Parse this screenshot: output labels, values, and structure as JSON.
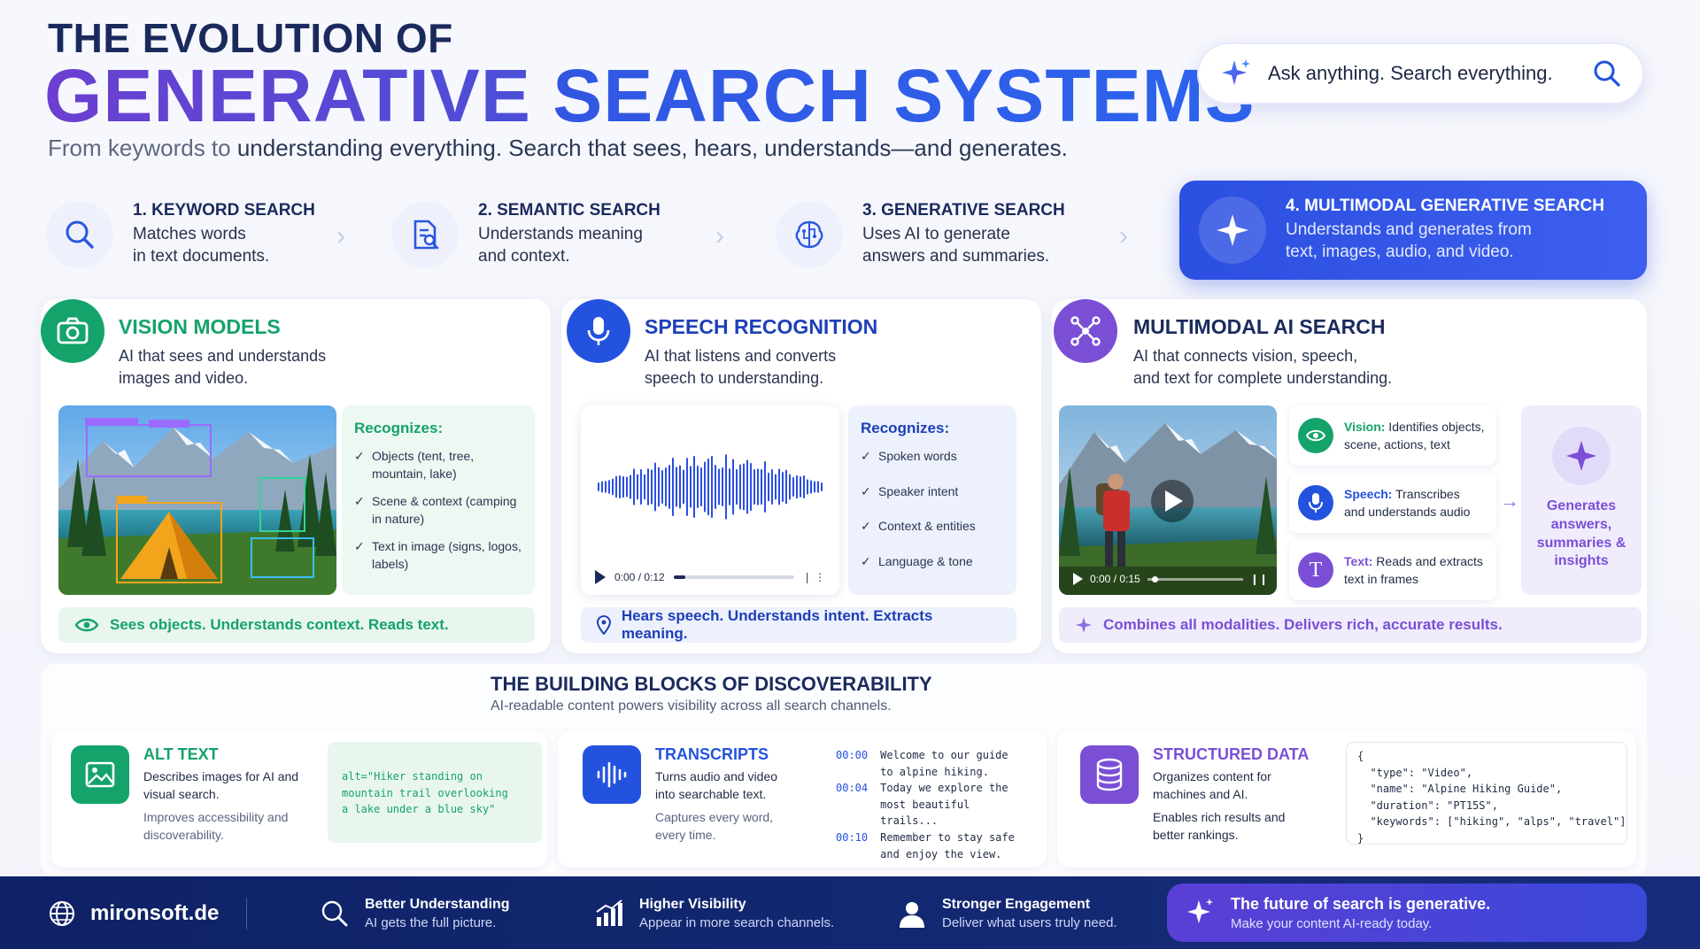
{
  "header": {
    "kicker": "THE EVOLUTION OF",
    "title_part1": "GENERATIVE",
    "title_part2": "SEARCH SYSTEMS",
    "subtitle_muted": "From keywords to",
    "subtitle_rest": " understanding everything. Search that sees, hears, understands—and generates."
  },
  "search": {
    "placeholder": "Ask anything. Search everything."
  },
  "steps": [
    {
      "title": "1. KEYWORD SEARCH",
      "line1": "Matches words",
      "line2": "in text documents."
    },
    {
      "title": "2. SEMANTIC SEARCH",
      "line1": "Understands meaning",
      "line2": "and context."
    },
    {
      "title": "3. GENERATIVE SEARCH",
      "line1": "Uses AI to generate",
      "line2": "answers and summaries."
    },
    {
      "title": "4. MULTIMODAL GENERATIVE SEARCH",
      "line1": "Understands and generates from",
      "line2": "text, images, audio, and video."
    }
  ],
  "vision": {
    "title": "VISION MODELS",
    "line1": "AI that sees and understands",
    "line2": "images and video.",
    "recognizes_label": "Recognizes:",
    "items": [
      "Objects (tent, tree, mountain, lake)",
      "Scene & context (camping in nature)",
      "Text in image (signs, logos, labels)"
    ],
    "footer": "Sees objects. Understands context. Reads text."
  },
  "speech": {
    "title": "SPEECH RECOGNITION",
    "line1": "AI that listens and converts",
    "line2": "speech to understanding.",
    "time": "0:00 / 0:12",
    "player_progress": 0.1,
    "recognizes_label": "Recognizes:",
    "items": [
      "Spoken words",
      "Speaker intent",
      "Context & entities",
      "Language & tone"
    ],
    "footer": "Hears speech. Understands intent. Extracts meaning."
  },
  "multimodal": {
    "title": "MULTIMODAL AI SEARCH",
    "line1": "AI that connects vision, speech,",
    "line2": "and text for complete understanding.",
    "time": "0:00 / 0:15",
    "player_progress": 0.05,
    "modes": [
      {
        "label": "Vision:",
        "text": " Identifies objects,",
        "text2": "scene, actions, text"
      },
      {
        "label": "Speech:",
        "text": " Transcribes",
        "text2": "and understands audio"
      },
      {
        "label": "Text:",
        "text": " Reads and extracts",
        "text2": "text in frames"
      }
    ],
    "text_icon_glyph": "T",
    "output": "Generates answers, summaries & insights",
    "footer": "Combines all modalities. Delivers rich, accurate results."
  },
  "blocks": {
    "title": "THE BUILDING BLOCKS OF DISCOVERABILITY",
    "subtitle": "AI-readable content powers visibility across all search channels.",
    "alt": {
      "title": "ALT TEXT",
      "d1": "Describes images for AI and",
      "d2": "visual search.",
      "m1": "Improves accessibility and",
      "m2": "discoverability.",
      "code": [
        "alt=\"Hiker standing on",
        "mountain trail overlooking",
        "a lake under a blue sky\""
      ]
    },
    "transcripts": {
      "title": "TRANSCRIPTS",
      "d1": "Turns audio and video",
      "d2": "into searchable text.",
      "m1": "Captures every word,",
      "m2": "every time.",
      "lines": [
        {
          "ts": "00:00",
          "l1": "Welcome to our guide",
          "l2": "to alpine hiking."
        },
        {
          "ts": "00:04",
          "l1": "Today we explore the",
          "l2": "most beautiful trails..."
        },
        {
          "ts": "00:10",
          "l1": "Remember to stay safe",
          "l2": "and enjoy the view."
        }
      ]
    },
    "structured": {
      "title": "STRUCTURED DATA",
      "d1": "Organizes content for",
      "d2": "machines and AI.",
      "m1": "Enables rich results and",
      "m2": "better rankings.",
      "json": [
        "{",
        "  \"type\": \"Video\",",
        "  \"name\": \"Alpine Hiking Guide\",",
        "  \"duration\": \"PT15S\",",
        "  \"keywords\": [\"hiking\", \"alps\", \"travel\"]",
        "}"
      ]
    }
  },
  "footer": {
    "brand": "mironsoft.de",
    "items": [
      {
        "title": "Better Understanding",
        "desc": "AI gets the full picture."
      },
      {
        "title": "Higher Visibility",
        "desc": "Appear in more search channels."
      },
      {
        "title": "Stronger Engagement",
        "desc": "Deliver what users truly need."
      }
    ],
    "cta_title": "The future of search is generative.",
    "cta_desc": "Make your content AI-ready today."
  },
  "colors": {
    "vision": "#14a36b",
    "speech": "#2352df",
    "multimodal": "#7a4fd6",
    "navy": "#1b2a5c"
  }
}
